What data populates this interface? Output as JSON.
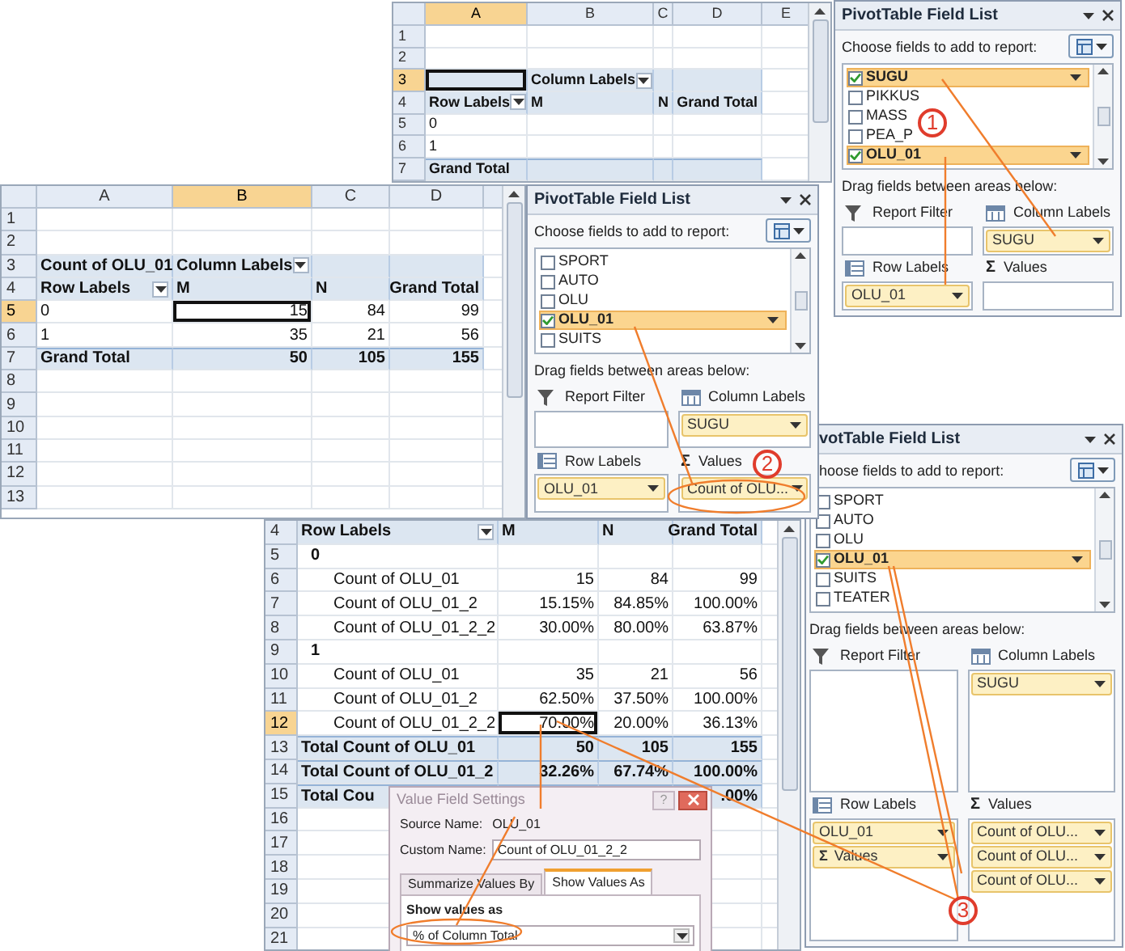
{
  "sheets": [
    {
      "columns": [
        {
          "label": "A",
          "selected": true
        },
        {
          "label": "B",
          "selected": false
        },
        {
          "label": "C",
          "selected": false
        },
        {
          "label": "D",
          "selected": false
        },
        {
          "label": "E",
          "selected": false
        }
      ],
      "rows": [
        {
          "number": "1",
          "selected": false,
          "kind": "data",
          "cells": []
        },
        {
          "number": "2",
          "selected": false,
          "kind": "data",
          "cells": []
        },
        {
          "number": "3",
          "selected": true,
          "kind": "header",
          "cells": [
            {
              "active": true
            },
            {
              "text": "Column Labels",
              "bold": true,
              "dropdown": true
            },
            {},
            {}
          ]
        },
        {
          "number": "4",
          "selected": false,
          "kind": "header",
          "cells": [
            {
              "text": "Row Labels",
              "bold": true,
              "dropdown": true
            },
            {
              "text": "M",
              "bold": true
            },
            {
              "text": "N",
              "bold": true,
              "kind": "value"
            },
            {
              "text": "Grand Total",
              "bold": true,
              "kind": "value"
            }
          ]
        },
        {
          "number": "5",
          "selected": false,
          "kind": "data",
          "cells": [
            {
              "text": "0"
            },
            {},
            {},
            {}
          ]
        },
        {
          "number": "6",
          "selected": false,
          "kind": "data",
          "cells": [
            {
              "text": "1"
            },
            {},
            {},
            {}
          ]
        },
        {
          "number": "7",
          "selected": false,
          "kind": "total",
          "cells": [
            {
              "text": "Grand Total",
              "bold": true
            },
            {},
            {},
            {}
          ]
        }
      ]
    },
    {
      "columns": [
        {
          "label": "A",
          "selected": false
        },
        {
          "label": "B",
          "selected": true
        },
        {
          "label": "C",
          "selected": false
        },
        {
          "label": "D",
          "selected": false
        }
      ],
      "rows": [
        {
          "number": "1",
          "selected": false,
          "kind": "data",
          "cells": []
        },
        {
          "number": "2",
          "selected": false,
          "kind": "data",
          "cells": []
        },
        {
          "number": "3",
          "selected": false,
          "kind": "header",
          "cells": [
            {
              "text": "Count of OLU_01",
              "bold": true
            },
            {
              "text": "Column Labels",
              "bold": true,
              "dropdown": true
            },
            {},
            {}
          ]
        },
        {
          "number": "4",
          "selected": false,
          "kind": "header",
          "cells": [
            {
              "text": "Row Labels",
              "bold": true,
              "dropdown": true
            },
            {
              "text": "M",
              "bold": true
            },
            {
              "text": "N",
              "bold": true
            },
            {
              "text": "Grand Total",
              "bold": true,
              "kind": "value"
            }
          ]
        },
        {
          "number": "5",
          "selected": true,
          "kind": "data",
          "cells": [
            {
              "text": "0"
            },
            {
              "text": "15",
              "kind": "value",
              "active": true
            },
            {
              "text": "84",
              "kind": "value"
            },
            {
              "text": "99",
              "kind": "value"
            }
          ]
        },
        {
          "number": "6",
          "selected": false,
          "kind": "data",
          "cells": [
            {
              "text": "1"
            },
            {
              "text": "35",
              "kind": "value"
            },
            {
              "text": "21",
              "kind": "value"
            },
            {
              "text": "56",
              "kind": "value"
            }
          ]
        },
        {
          "number": "7",
          "selected": false,
          "kind": "total",
          "cells": [
            {
              "text": "Grand Total",
              "bold": true
            },
            {
              "text": "50",
              "bold": true,
              "kind": "value"
            },
            {
              "text": "105",
              "bold": true,
              "kind": "value"
            },
            {
              "text": "155",
              "bold": true,
              "kind": "value"
            }
          ]
        },
        {
          "number": "8",
          "selected": false,
          "kind": "data",
          "cells": []
        },
        {
          "number": "9",
          "selected": false,
          "kind": "data",
          "cells": []
        },
        {
          "number": "10",
          "selected": false,
          "kind": "data",
          "cells": []
        },
        {
          "number": "11",
          "selected": false,
          "kind": "data",
          "cells": []
        },
        {
          "number": "12",
          "selected": false,
          "kind": "data",
          "cells": []
        },
        {
          "number": "13",
          "selected": false,
          "kind": "data",
          "cells": []
        }
      ]
    },
    {
      "rows": [
        {
          "number": "4",
          "selected": false,
          "kind": "header",
          "cells": [
            {
              "text": "Row Labels",
              "bold": true,
              "dropdown": true
            },
            {
              "text": "M",
              "bold": true
            },
            {
              "text": "N",
              "bold": true
            },
            {
              "text": "Grand Total",
              "bold": true,
              "kind": "value"
            }
          ]
        },
        {
          "number": "5",
          "selected": false,
          "kind": "data",
          "cells": [
            {
              "text": "0",
              "bold": true,
              "kind": "group"
            },
            {},
            {},
            {}
          ]
        },
        {
          "number": "6",
          "selected": false,
          "kind": "data",
          "cells": [
            {
              "text": "Count of OLU_01",
              "kind": "sub"
            },
            {
              "text": "15",
              "kind": "value"
            },
            {
              "text": "84",
              "kind": "value"
            },
            {
              "text": "99",
              "kind": "value"
            }
          ]
        },
        {
          "number": "7",
          "selected": false,
          "kind": "data",
          "cells": [
            {
              "text": "Count of OLU_01_2",
              "kind": "sub"
            },
            {
              "text": "15.15%",
              "kind": "value"
            },
            {
              "text": "84.85%",
              "kind": "value"
            },
            {
              "text": "100.00%",
              "kind": "value"
            }
          ]
        },
        {
          "number": "8",
          "selected": false,
          "kind": "data",
          "cells": [
            {
              "text": "Count of OLU_01_2_2",
              "kind": "sub"
            },
            {
              "text": "30.00%",
              "kind": "value"
            },
            {
              "text": "80.00%",
              "kind": "value"
            },
            {
              "text": "63.87%",
              "kind": "value"
            }
          ]
        },
        {
          "number": "9",
          "selected": false,
          "kind": "data",
          "cells": [
            {
              "text": "1",
              "bold": true,
              "kind": "group"
            },
            {},
            {},
            {}
          ]
        },
        {
          "number": "10",
          "selected": false,
          "kind": "data",
          "cells": [
            {
              "text": "Count of OLU_01",
              "kind": "sub"
            },
            {
              "text": "35",
              "kind": "value"
            },
            {
              "text": "21",
              "kind": "value"
            },
            {
              "text": "56",
              "kind": "value"
            }
          ]
        },
        {
          "number": "11",
          "selected": false,
          "kind": "data",
          "cells": [
            {
              "text": "Count of OLU_01_2",
              "kind": "sub"
            },
            {
              "text": "62.50%",
              "kind": "value"
            },
            {
              "text": "37.50%",
              "kind": "value"
            },
            {
              "text": "100.00%",
              "kind": "value"
            }
          ]
        },
        {
          "number": "12",
          "selected": true,
          "kind": "data",
          "cells": [
            {
              "text": "Count of OLU_01_2_2",
              "kind": "sub"
            },
            {
              "text": "70.00%",
              "kind": "value",
              "active": true
            },
            {
              "text": "20.00%",
              "kind": "value"
            },
            {
              "text": "36.13%",
              "kind": "value"
            }
          ]
        },
        {
          "number": "13",
          "selected": false,
          "kind": "total",
          "cells": [
            {
              "text": "Total Count of OLU_01",
              "bold": true
            },
            {
              "text": "50",
              "bold": true,
              "kind": "value"
            },
            {
              "text": "105",
              "bold": true,
              "kind": "value"
            },
            {
              "text": "155",
              "bold": true,
              "kind": "value"
            }
          ]
        },
        {
          "number": "14",
          "selected": false,
          "kind": "total",
          "cells": [
            {
              "text": "Total Count of OLU_01_2",
              "bold": true
            },
            {
              "text": "32.26%",
              "bold": true,
              "kind": "value"
            },
            {
              "text": "67.74%",
              "bold": true,
              "kind": "value"
            },
            {
              "text": "100.00%",
              "bold": true,
              "kind": "value"
            }
          ]
        },
        {
          "number": "15",
          "selected": false,
          "kind": "total",
          "cells": [
            {
              "text": "Total Cou",
              "bold": true
            },
            {},
            {},
            {
              "text": ".00%",
              "bold": true,
              "kind": "value"
            }
          ]
        },
        {
          "number": "16",
          "selected": false,
          "kind": "data",
          "cells": []
        },
        {
          "number": "17",
          "selected": false,
          "kind": "data",
          "cells": []
        },
        {
          "number": "18",
          "selected": false,
          "kind": "data",
          "cells": []
        },
        {
          "number": "19",
          "selected": false,
          "kind": "data",
          "cells": []
        },
        {
          "number": "20",
          "selected": false,
          "kind": "data",
          "cells": []
        },
        {
          "number": "21",
          "selected": false,
          "kind": "data",
          "cells": []
        }
      ]
    }
  ],
  "field_lists": [
    {
      "title": "PivotTable Field List",
      "prompt": "Choose fields to add to report:",
      "fields": [
        {
          "name": "SUGU",
          "checked": true,
          "selected": true
        },
        {
          "name": "PIKKUS",
          "checked": false,
          "selected": false
        },
        {
          "name": "MASS",
          "checked": false,
          "selected": false
        },
        {
          "name": "PEA_P",
          "checked": false,
          "selected": false
        },
        {
          "name": "OLU_01",
          "checked": true,
          "selected": true
        }
      ],
      "areas_prompt": "Drag fields between areas below:",
      "areas": [
        {
          "kind": "filter",
          "label": "Report Filter"
        },
        {
          "kind": "columns",
          "label": "Column Labels",
          "items": [
            {
              "text": "SUGU"
            }
          ]
        },
        {
          "kind": "rows",
          "label": "Row Labels",
          "items": [
            {
              "text": "OLU_01"
            }
          ]
        },
        {
          "kind": "values",
          "symbol": "Σ",
          "label": "Values"
        }
      ]
    },
    {
      "title": "PivotTable Field List",
      "prompt": "Choose fields to add to report:",
      "fields": [
        {
          "name": "SPORT",
          "checked": false,
          "selected": false
        },
        {
          "name": "AUTO",
          "checked": false,
          "selected": false
        },
        {
          "name": "OLU",
          "checked": false,
          "selected": false
        },
        {
          "name": "OLU_01",
          "checked": true,
          "selected": true
        },
        {
          "name": "SUITS",
          "checked": false,
          "selected": false
        }
      ],
      "areas_prompt": "Drag fields between areas below:",
      "areas": [
        {
          "kind": "filter",
          "label": "Report Filter"
        },
        {
          "kind": "columns",
          "label": "Column Labels",
          "items": [
            {
              "text": "SUGU"
            }
          ]
        },
        {
          "kind": "rows",
          "label": "Row Labels",
          "items": [
            {
              "text": "OLU_01"
            }
          ]
        },
        {
          "kind": "values",
          "symbol": "Σ",
          "label": "Values",
          "items": [
            {
              "text": "Count of OLU..."
            }
          ]
        }
      ]
    },
    {
      "title": "votTable Field List",
      "prompt": "hoose fields to add to report:",
      "fields": [
        {
          "name": "SPORT",
          "checked": false,
          "selected": false
        },
        {
          "name": "AUTO",
          "checked": false,
          "selected": false
        },
        {
          "name": "OLU",
          "checked": false,
          "selected": false
        },
        {
          "name": "OLU_01",
          "checked": true,
          "selected": true
        },
        {
          "name": "SUITS",
          "checked": false,
          "selected": false
        },
        {
          "name": "TEATER",
          "checked": false,
          "selected": false
        }
      ],
      "areas_prompt": "Drag fields between areas below:",
      "areas": [
        {
          "kind": "filter",
          "label": "Report Filter"
        },
        {
          "kind": "columns",
          "label": "Column Labels",
          "items": [
            {
              "text": "SUGU"
            }
          ]
        },
        {
          "kind": "rows",
          "label": "Row Labels",
          "items": [
            {
              "text": "OLU_01"
            },
            {
              "symbol": "Σ",
              "text": "Values"
            }
          ]
        },
        {
          "kind": "values",
          "symbol": "Σ",
          "label": "Values",
          "items": [
            {
              "text": "Count of OLU..."
            },
            {
              "text": "Count of OLU..."
            },
            {
              "text": "Count of OLU..."
            }
          ]
        }
      ]
    }
  ],
  "dialog": {
    "title": "Value Field Settings",
    "help": "?",
    "source_label": "Source Name:",
    "source_value": "OLU_01",
    "custom_label": "Custom Name:",
    "custom_value": "Count of OLU_01_2_2",
    "tabs": [
      {
        "label": "Summarize Values By",
        "selected": false
      },
      {
        "label": "Show Values As",
        "selected": true
      }
    ],
    "group_title": "Show values as",
    "dropdown_value": "% of Column Total"
  },
  "callouts": [
    {
      "number": "1"
    },
    {
      "number": "2"
    },
    {
      "number": "3"
    }
  ]
}
